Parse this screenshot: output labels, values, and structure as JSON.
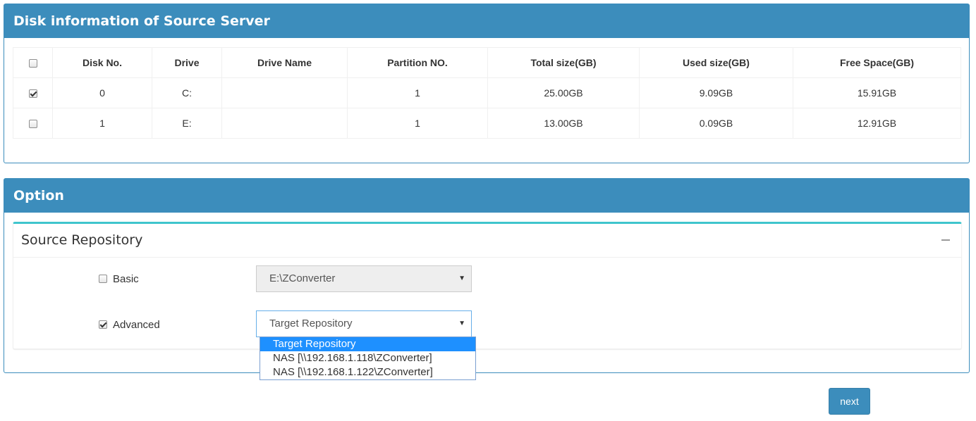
{
  "disk_panel": {
    "title": "Disk information of Source Server",
    "columns": [
      "Disk No.",
      "Drive",
      "Drive Name",
      "Partition NO.",
      "Total size(GB)",
      "Used size(GB)",
      "Free Space(GB)"
    ],
    "rows": [
      {
        "checked": true,
        "disk_no": "0",
        "drive": "C:",
        "drive_name": "",
        "partition": "1",
        "total": "25.00GB",
        "used": "9.09GB",
        "free": "15.91GB"
      },
      {
        "checked": false,
        "disk_no": "1",
        "drive": "E:",
        "drive_name": "",
        "partition": "1",
        "total": "13.00GB",
        "used": "0.09GB",
        "free": "12.91GB"
      }
    ]
  },
  "option_panel": {
    "title": "Option",
    "source_repository": {
      "title": "Source Repository",
      "basic": {
        "label": "Basic",
        "checked": false,
        "value": "E:\\ZConverter"
      },
      "advanced": {
        "label": "Advanced",
        "checked": true,
        "value": "Target Repository",
        "options": [
          "Target Repository",
          "NAS [\\\\192.168.1.118\\ZConverter]",
          "NAS [\\\\192.168.1.122\\ZConverter]"
        ],
        "highlighted_option": "Target Repository"
      }
    }
  },
  "footer": {
    "next_label": "next"
  },
  "colors": {
    "header": "#3c8dbc",
    "box_accent": "#3fc5cd",
    "selected_option": "#1e90ff"
  }
}
